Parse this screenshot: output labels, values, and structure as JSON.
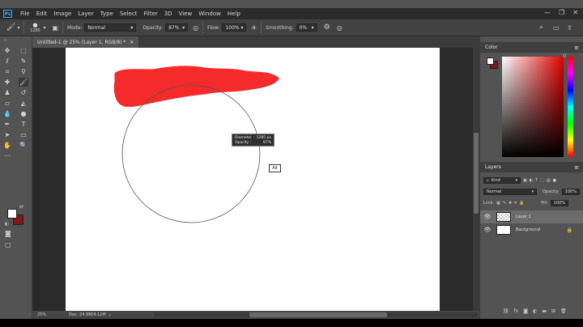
{
  "menubar": {
    "items": [
      "File",
      "Edit",
      "Image",
      "Layer",
      "Type",
      "Select",
      "Filter",
      "3D",
      "View",
      "Window",
      "Help"
    ]
  },
  "optionsbar": {
    "brush_size": "1285",
    "mode_label": "Mode:",
    "mode_value": "Normal",
    "opacity_label": "Opacity:",
    "opacity_value": "87%",
    "flow_label": "Flow:",
    "flow_value": "100%",
    "smoothing_label": "Smoothing:",
    "smoothing_value": "0%"
  },
  "document": {
    "tab_title": "Untitled-1 @ 25% (Layer 1, RGB/8) *",
    "zoom": "25%",
    "doc_info": "Doc: 24.9M/4.12M",
    "stroke_color": "#f52a2a"
  },
  "tooltip": {
    "diameter_label": "Diameter :",
    "diameter_value": "1285 px",
    "opacity_label": "Opacity :",
    "opacity_value": "87%"
  },
  "alt_badge": "Alt",
  "color_panel": {
    "title": "Color",
    "fg": "#ffffff",
    "bg": "#7b1b1b"
  },
  "layers_panel": {
    "title": "Layers",
    "kind_label": "Kind",
    "blend_mode": "Normal",
    "opacity_label": "Opacity:",
    "opacity_value": "100%",
    "lock_label": "Lock:",
    "fill_label": "Fill:",
    "fill_value": "100%",
    "layers": [
      {
        "name": "Layer 1",
        "selected": true
      },
      {
        "name": "Background",
        "selected": false
      }
    ]
  }
}
